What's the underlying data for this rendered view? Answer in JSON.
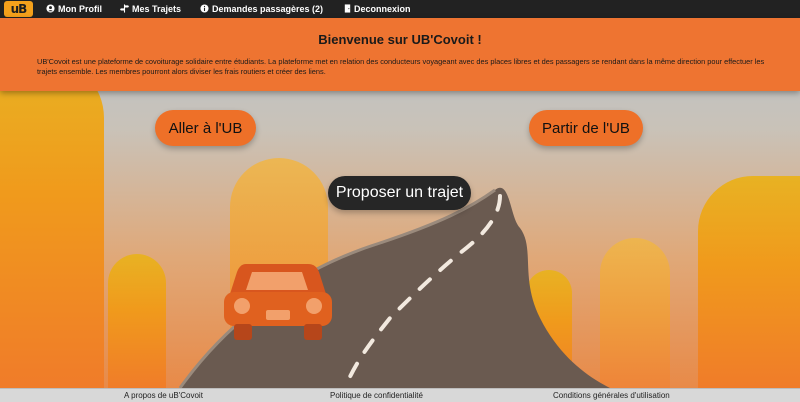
{
  "brand": {
    "logo_text": "uB",
    "logo_color": "#f5a11b"
  },
  "nav": {
    "items": [
      {
        "label": "Mon Profil",
        "icon": "user-circle-icon"
      },
      {
        "label": "Mes Trajets",
        "icon": "road-signpost-icon"
      },
      {
        "label": "Demandes passagères (2)",
        "icon": "info-circle-icon"
      },
      {
        "label": "Deconnexion",
        "icon": "door-exit-icon"
      }
    ]
  },
  "banner": {
    "title": "Bienvenue sur UB'Covoit !",
    "description": "UB'Covoit est une plateforme de covoiturage solidaire entre étudiants. La plateforme met en relation des conducteurs voyageant avec des places libres et des passagers se rendant dans la même direction pour effectuer les trajets ensemble. Les membres pourront alors diviser les frais routiers et créer des liens.",
    "color": "#ee7431"
  },
  "actions": {
    "go_to": "Aller à l'UB",
    "leave_from": "Partir de l'UB",
    "propose": "Proposer un trajet"
  },
  "footer": {
    "links": [
      "A propos de uB'Covoit",
      "Politique de confidentialité",
      "Conditions générales d'utilisation"
    ]
  },
  "colors": {
    "accent": "#ee7028",
    "navbar": "#222222",
    "dark_button": "#262626"
  }
}
